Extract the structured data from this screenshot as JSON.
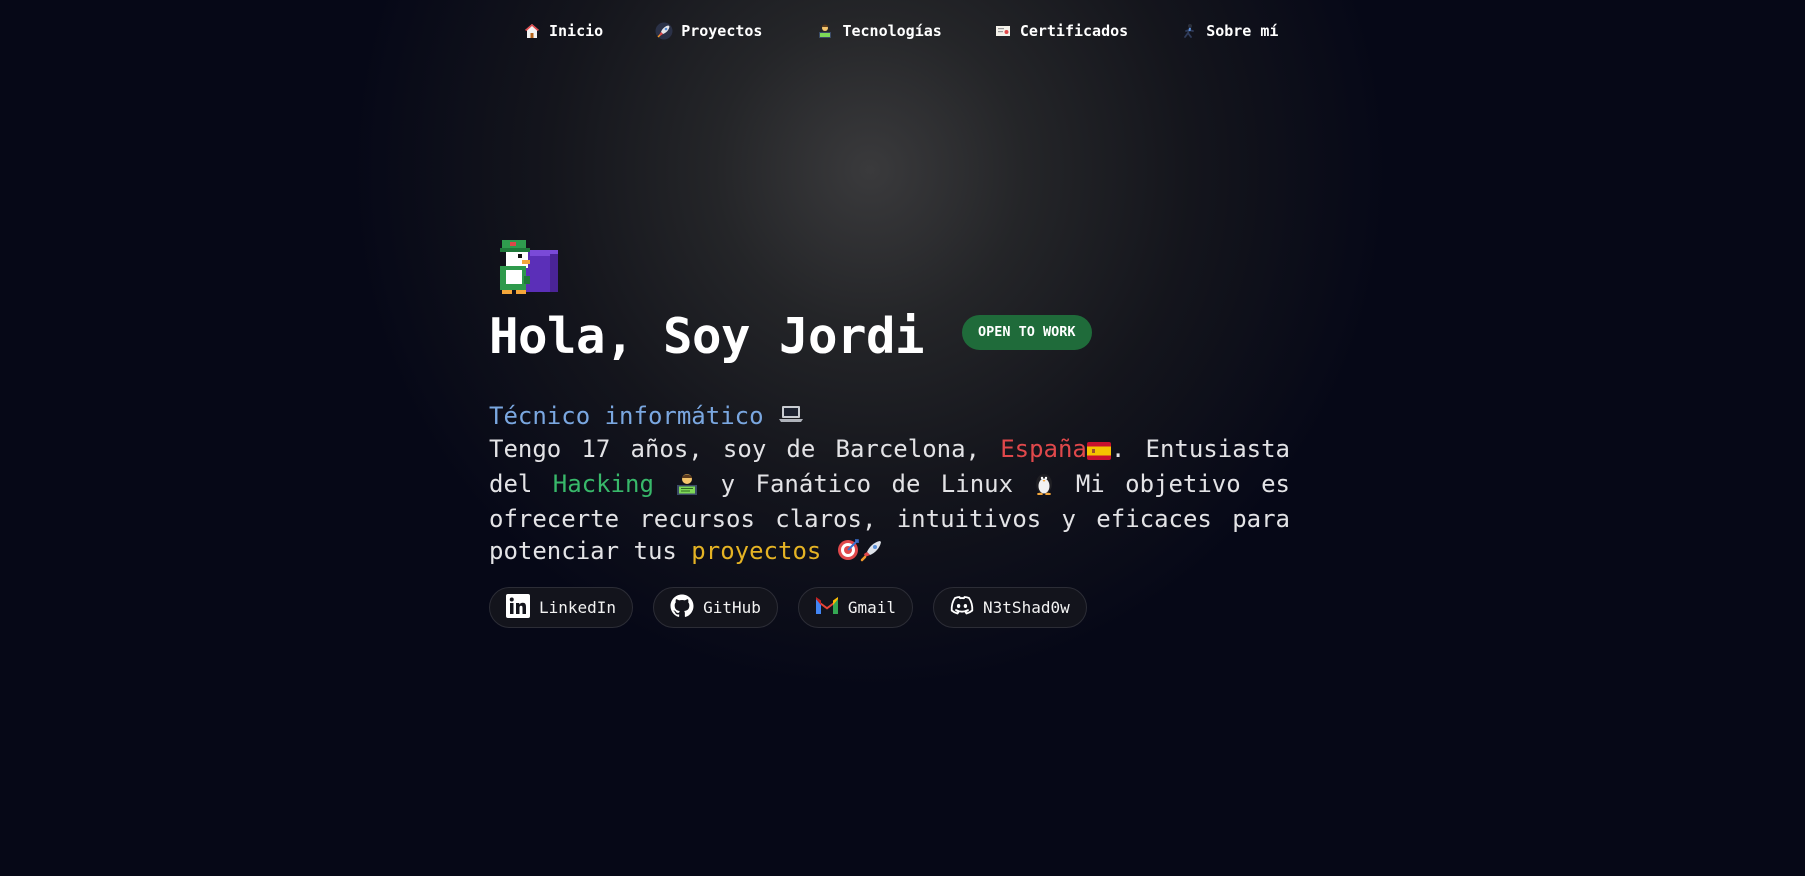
{
  "nav": {
    "items": [
      {
        "label": "Inicio",
        "icon": "house-icon"
      },
      {
        "label": "Proyectos",
        "icon": "rocket-icon"
      },
      {
        "label": "Tecnologías",
        "icon": "technologist-icon"
      },
      {
        "label": "Certificados",
        "icon": "certificate-icon"
      },
      {
        "label": "Sobre mí",
        "icon": "person-icon"
      }
    ]
  },
  "hero": {
    "avatar_icon": "pixel-character-icon",
    "title": "Hola, Soy Jordi",
    "badge": "OPEN TO WORK",
    "role": "Técnico informático",
    "desc": {
      "p1": "Tengo 17 años, soy de Barcelona, ",
      "country": "España",
      "p2": ". Entusiasta del ",
      "hacking": "Hacking",
      "p3": " y Fanático de Linux ",
      "p4": " Mi objetivo es ofrecerte recursos claros, intuitivos y eficaces para potenciar tus ",
      "projects": "proyectos"
    }
  },
  "socials": [
    {
      "label": "LinkedIn",
      "icon": "linkedin-icon"
    },
    {
      "label": "GitHub",
      "icon": "github-icon"
    },
    {
      "label": "Gmail",
      "icon": "gmail-icon"
    },
    {
      "label": "N3tShad0w",
      "icon": "discord-icon"
    }
  ],
  "colors": {
    "background": "#050816",
    "badge": "#1f6b3a",
    "role": "#7aa7e0",
    "country": "#e0484b",
    "hacking": "#38b86a",
    "projects": "#e5b324"
  }
}
